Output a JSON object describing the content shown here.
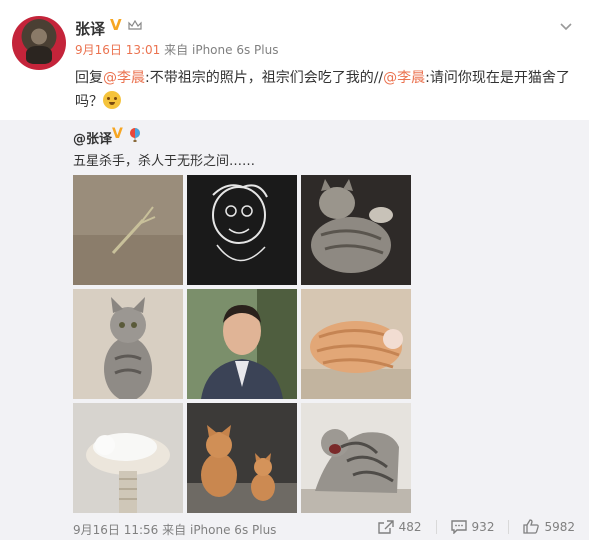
{
  "post": {
    "author": "张译",
    "date": "9月16日",
    "time": "13:01",
    "source_prefix": "来自",
    "source": "iPhone 6s Plus",
    "reply_prefix": "回复",
    "mention1": "@李晨",
    "text1": ":不带祖宗的照片，祖宗们会吃了我的//",
    "mention2": "@李晨",
    "text2": ":请问你现在是开猫舍了吗？",
    "emoji": "smile-emoji"
  },
  "repost": {
    "author": "@张译",
    "text": "五星杀手，杀人于无形之间……",
    "images": [
      {
        "name": "mantis"
      },
      {
        "name": "caricature"
      },
      {
        "name": "tabby-cat-lying"
      },
      {
        "name": "tabby-cat-sitting"
      },
      {
        "name": "man-portrait"
      },
      {
        "name": "orange-cat-sleeping"
      },
      {
        "name": "white-cat-bed"
      },
      {
        "name": "two-orange-cats"
      },
      {
        "name": "tabby-cat-hissing"
      }
    ],
    "date_time": "9月16日 11:56",
    "source_prefix": "来自",
    "source": "iPhone 6s Plus",
    "reposts": "482",
    "comments": "932",
    "likes": "5982"
  },
  "colors": {
    "accent": "#eb7350",
    "badge": "#f6a623",
    "repost_bg": "#f2f2f5"
  }
}
